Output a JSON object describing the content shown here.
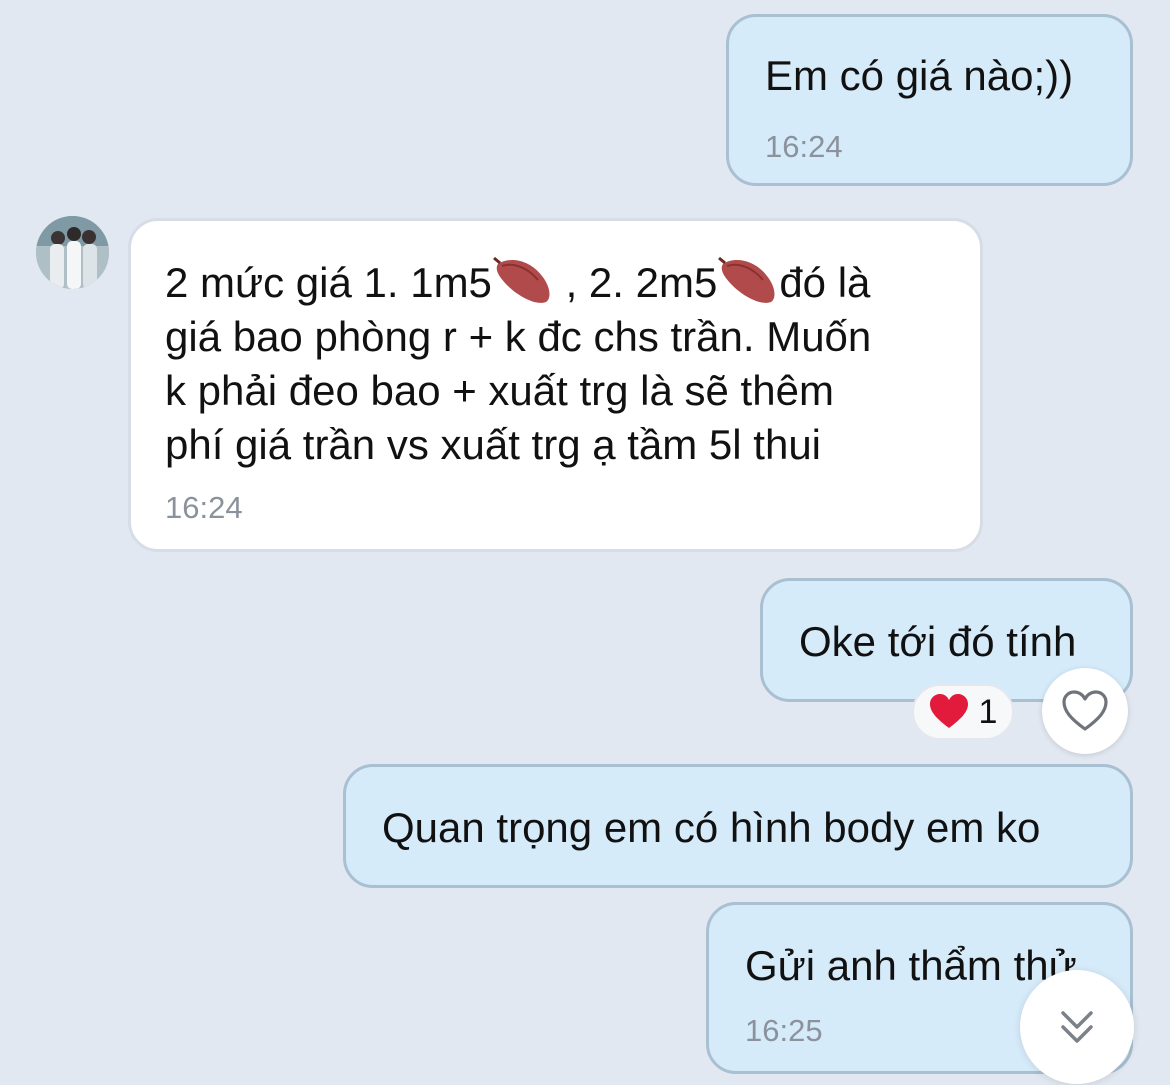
{
  "messages": [
    {
      "id": "msg1",
      "direction": "outgoing",
      "text": "Em có giá nào;))",
      "time": "16:24"
    },
    {
      "id": "msg2",
      "direction": "incoming",
      "lines": {
        "l1_a": "2 mức giá 1. 1m5",
        "l1_b": " , 2. 2m5",
        "l1_c": "đó là",
        "l2": "giá bao phòng r + k đc chs trần. Muốn",
        "l3": "k phải đeo bao + xuất trg là sẽ thêm",
        "l4": "phí giá trần vs xuất trg ạ tầm 5l thui"
      },
      "inline_icon": "sweet-potato-icon",
      "time": "16:24"
    },
    {
      "id": "msg3",
      "direction": "outgoing",
      "text": "Oke tới đó tính",
      "reaction": {
        "emoji": "❤️",
        "count": "1"
      }
    },
    {
      "id": "msg4",
      "direction": "outgoing",
      "text": "Quan trọng em có hình body em ko"
    },
    {
      "id": "msg5",
      "direction": "outgoing",
      "text": "Gửi anh thẩm thử",
      "time": "16:25"
    }
  ],
  "icons": {
    "add_reaction": "heart-outline-icon",
    "scroll_down": "double-chevron-down-icon",
    "avatar": "avatar"
  },
  "colors": {
    "background": "#e2e8f1",
    "outgoing_bubble": "#d6ebfa",
    "incoming_bubble": "#ffffff",
    "timestamp": "#8b929b",
    "reaction_heart": "#e21b3c"
  }
}
